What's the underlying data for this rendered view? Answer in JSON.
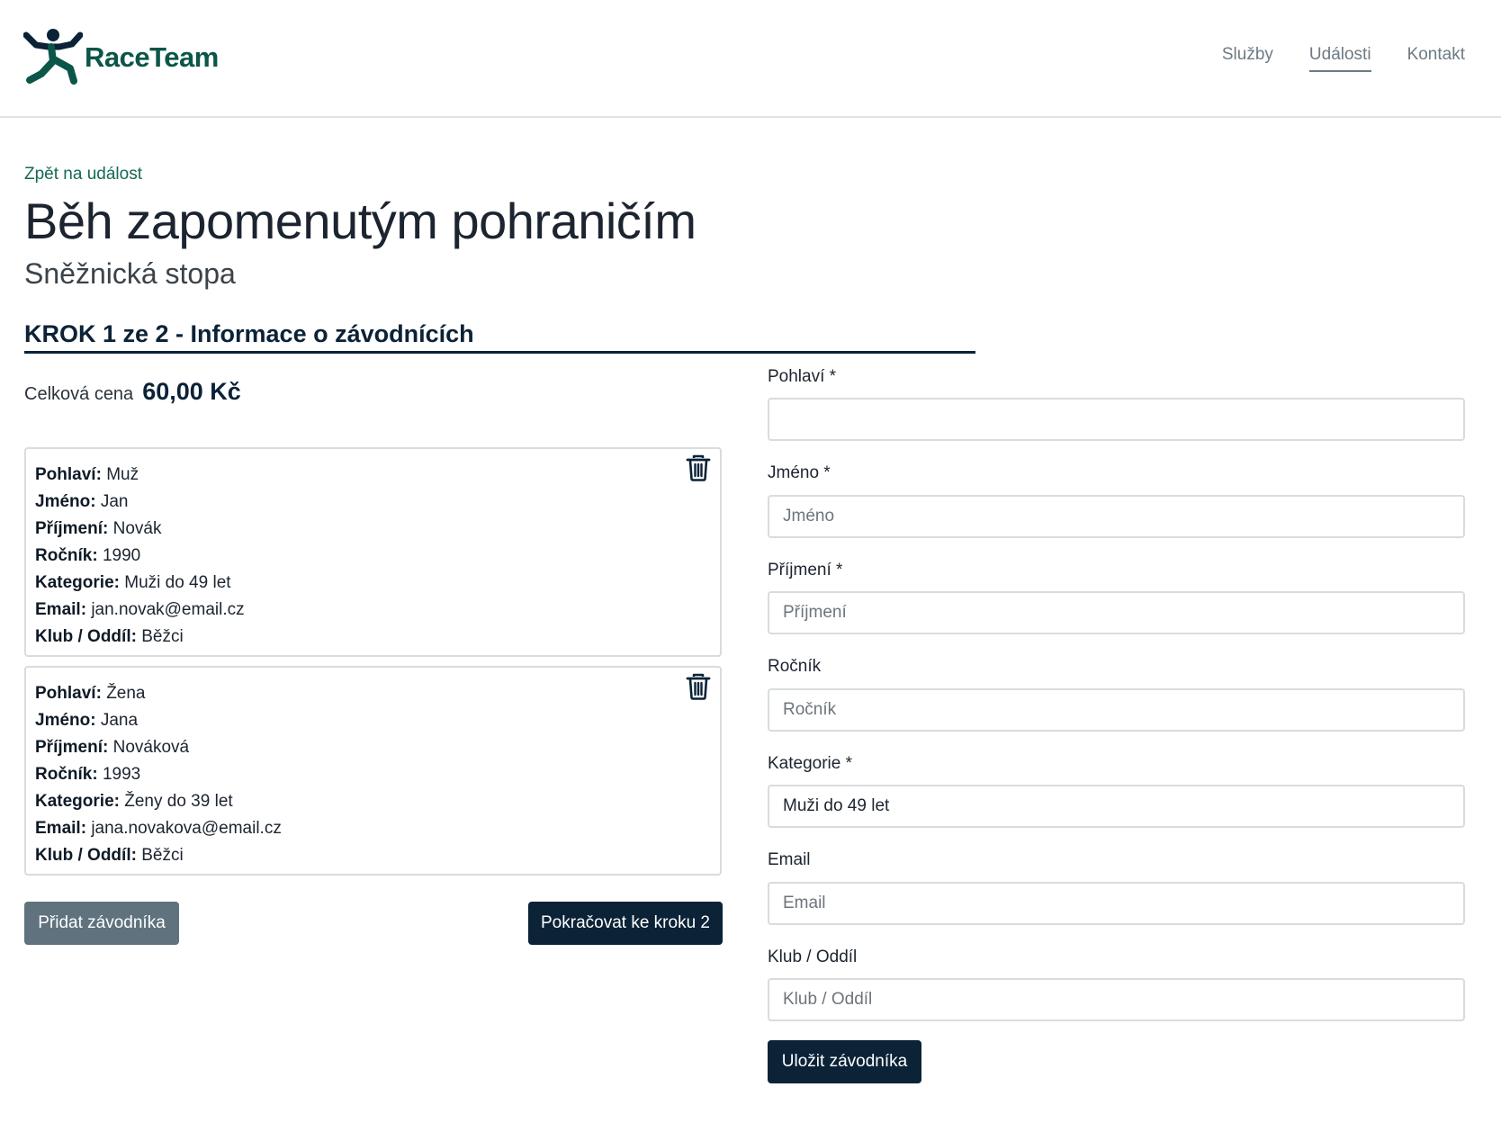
{
  "brand": {
    "name": "RaceTeam",
    "color": "#0b5648"
  },
  "nav": {
    "items": [
      {
        "label": "Služby",
        "active": false
      },
      {
        "label": "Události",
        "active": true
      },
      {
        "label": "Kontakt",
        "active": false
      }
    ]
  },
  "back_link": "Zpět na událost",
  "event": {
    "title": "Běh zapomenutým pohraničím",
    "subtitle": "Sněžnická stopa"
  },
  "step": {
    "heading": "KROK 1 ze 2 - Informace o závodnících"
  },
  "price": {
    "label": "Celková cena",
    "value": "60,00 Kč"
  },
  "racers": [
    {
      "rows": [
        {
          "key": "Pohlaví:",
          "value": "Muž"
        },
        {
          "key": "Jméno:",
          "value": "Jan"
        },
        {
          "key": "Příjmení:",
          "value": "Novák"
        },
        {
          "key": "Ročník:",
          "value": "1990"
        },
        {
          "key": "Kategorie:",
          "value": "Muži do 49 let"
        },
        {
          "key": "Email:",
          "value": "jan.novak@email.cz"
        },
        {
          "key": "Klub / Oddíl:",
          "value": "Běžci"
        }
      ]
    },
    {
      "rows": [
        {
          "key": "Pohlaví:",
          "value": "Žena"
        },
        {
          "key": "Jméno:",
          "value": "Jana"
        },
        {
          "key": "Příjmení:",
          "value": "Nováková"
        },
        {
          "key": "Ročník:",
          "value": "1993"
        },
        {
          "key": "Kategorie:",
          "value": "Ženy do 39 let"
        },
        {
          "key": "Email:",
          "value": "jana.novakova@email.cz"
        },
        {
          "key": "Klub / Oddíl:",
          "value": "Běžci"
        }
      ]
    }
  ],
  "buttons": {
    "add": "Přidat závodníka",
    "next": "Pokračovat ke kroku 2",
    "save": "Uložit závodníka"
  },
  "form": {
    "fields": [
      {
        "label": "Pohlaví *",
        "value": "",
        "placeholder": ""
      },
      {
        "label": "Jméno *",
        "value": "",
        "placeholder": "Jméno"
      },
      {
        "label": "Příjmení *",
        "value": "",
        "placeholder": "Příjmení"
      },
      {
        "label": "Ročník",
        "value": "",
        "placeholder": "Ročník"
      },
      {
        "label": "Kategorie *",
        "value": "Muži do 49 let",
        "placeholder": ""
      },
      {
        "label": "Email",
        "value": "",
        "placeholder": "Email"
      },
      {
        "label": "Klub / Oddíl",
        "value": "",
        "placeholder": "Klub / Oddíl"
      }
    ]
  },
  "icons": {
    "trash": "trash-icon",
    "logo": "runner-logo-icon"
  },
  "colors": {
    "primary": "#0b2237",
    "secondary_button": "#5f727e",
    "link": "#146a55"
  }
}
